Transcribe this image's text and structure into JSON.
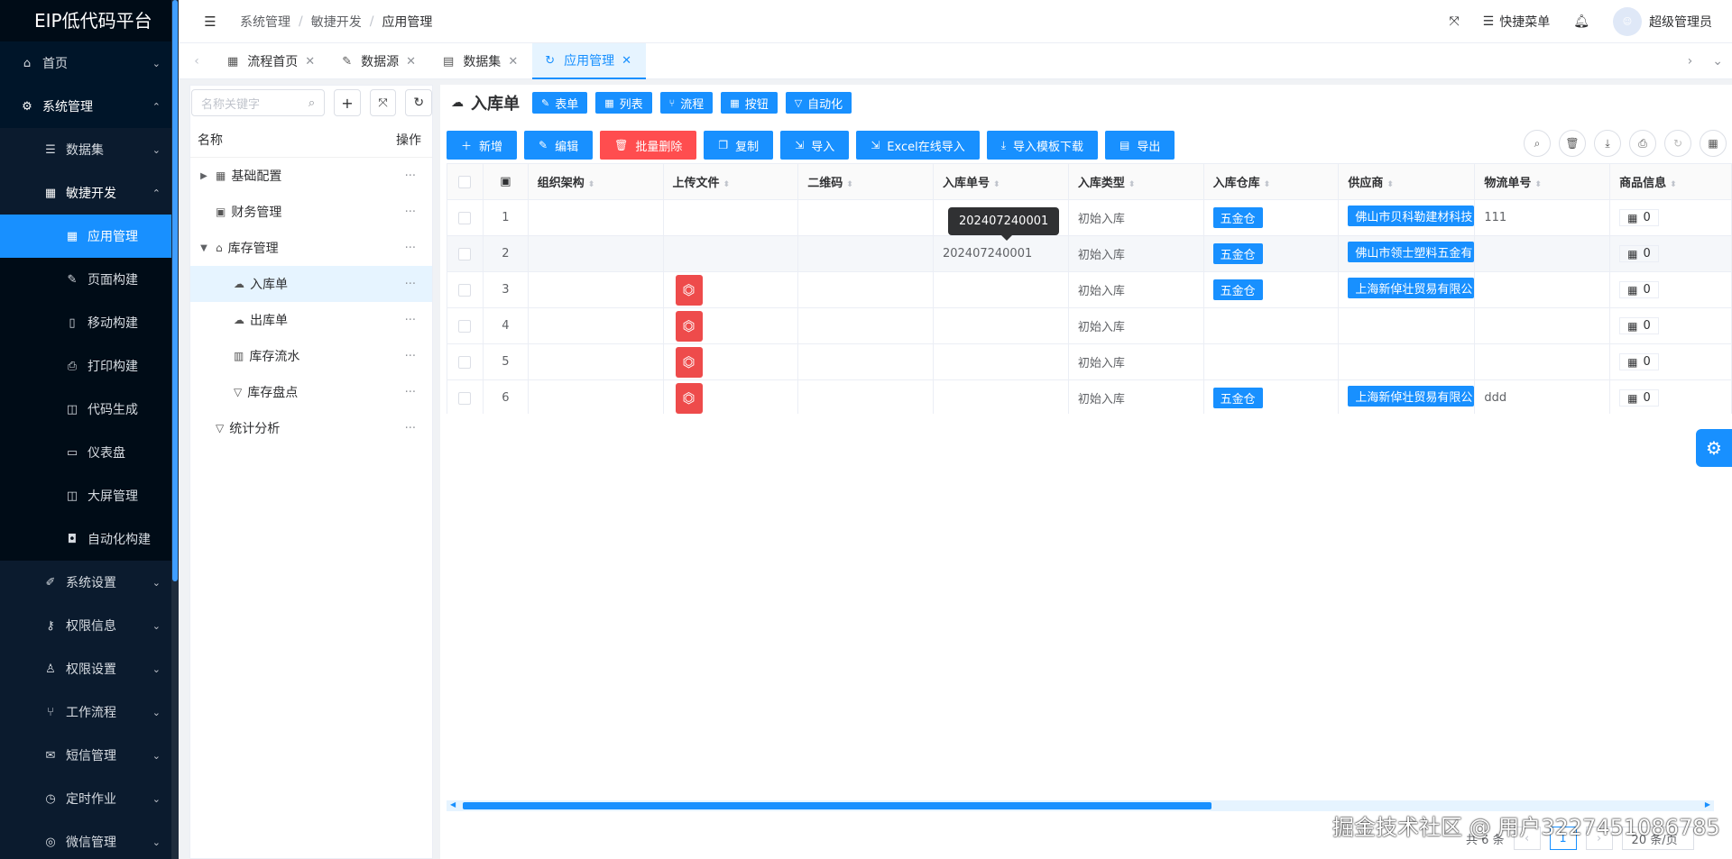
{
  "app": {
    "title": "EIP低代码平台"
  },
  "sidebar": {
    "items": [
      {
        "label": "首页",
        "icon": "home-icon"
      },
      {
        "label": "系统管理",
        "icon": "gear-icon"
      },
      {
        "label": "数据集",
        "icon": "list-icon"
      },
      {
        "label": "敏捷开发",
        "icon": "grid-icon"
      },
      {
        "label": "应用管理",
        "icon": "grid-icon"
      },
      {
        "label": "页面构建",
        "icon": "edit-icon"
      },
      {
        "label": "移动构建",
        "icon": "mobile-icon"
      },
      {
        "label": "打印构建",
        "icon": "printer-icon"
      },
      {
        "label": "代码生成",
        "icon": "code-icon"
      },
      {
        "label": "仪表盘",
        "icon": "dashboard-icon"
      },
      {
        "label": "大屏管理",
        "icon": "screen-icon"
      },
      {
        "label": "自动化构建",
        "icon": "robot-icon"
      },
      {
        "label": "系统设置",
        "icon": "wrench-icon"
      },
      {
        "label": "权限信息",
        "icon": "key-icon"
      },
      {
        "label": "权限设置",
        "icon": "user-icon"
      },
      {
        "label": "工作流程",
        "icon": "branch-icon"
      },
      {
        "label": "短信管理",
        "icon": "sms-icon"
      },
      {
        "label": "定时作业",
        "icon": "clock-icon"
      },
      {
        "label": "微信管理",
        "icon": "wechat-icon"
      }
    ]
  },
  "header": {
    "breadcrumb": [
      "系统管理",
      "敏捷开发",
      "应用管理"
    ],
    "quick_menu": "快捷菜单",
    "user": "超级管理员"
  },
  "tabs": [
    {
      "label": "流程首页"
    },
    {
      "label": "数据源"
    },
    {
      "label": "数据集"
    },
    {
      "label": "应用管理"
    }
  ],
  "tree": {
    "search_placeholder": "名称关键字",
    "col_name": "名称",
    "col_op": "操作",
    "more": "···",
    "nodes": [
      {
        "label": "基础配置"
      },
      {
        "label": "财务管理"
      },
      {
        "label": "库存管理"
      },
      {
        "label": "入库单"
      },
      {
        "label": "出库单"
      },
      {
        "label": "库存流水"
      },
      {
        "label": "库存盘点"
      },
      {
        "label": "统计分析"
      }
    ]
  },
  "form": {
    "title": "入库单",
    "design_buttons": [
      "表单",
      "列表",
      "流程",
      "按钮",
      "自动化"
    ]
  },
  "toolbar": {
    "add": "新增",
    "edit": "编辑",
    "batch_delete": "批量删除",
    "copy": "复制",
    "import": "导入",
    "excel_import": "Excel在线导入",
    "template_download": "导入模板下载",
    "export": "导出"
  },
  "table": {
    "columns": [
      "组织架构",
      "上传文件",
      "二维码",
      "入库单号",
      "入库类型",
      "入库仓库",
      "供应商",
      "物流单号",
      "商品信息"
    ],
    "rows": [
      {
        "no": "1",
        "org": "",
        "file": false,
        "qr": "",
        "order_no": "",
        "type": "初始入库",
        "warehouse": "五金仓",
        "supplier": "佛山市贝科勒建材科技",
        "logistics": "111",
        "goods": "0"
      },
      {
        "no": "2",
        "org": "",
        "file": false,
        "qr": "",
        "order_no": "202407240001",
        "type": "初始入库",
        "warehouse": "五金仓",
        "supplier": "佛山市领士塑料五金有",
        "logistics": "",
        "goods": "0"
      },
      {
        "no": "3",
        "org": "",
        "file": true,
        "qr": "",
        "order_no": "",
        "type": "初始入库",
        "warehouse": "五金仓",
        "supplier": "上海新倬壮贸易有限公",
        "logistics": "",
        "goods": "0"
      },
      {
        "no": "4",
        "org": "",
        "file": true,
        "qr": "",
        "order_no": "",
        "type": "初始入库",
        "warehouse": "",
        "supplier": "",
        "logistics": "",
        "goods": "0"
      },
      {
        "no": "5",
        "org": "",
        "file": true,
        "qr": "",
        "order_no": "",
        "type": "初始入库",
        "warehouse": "",
        "supplier": "",
        "logistics": "",
        "goods": "0"
      },
      {
        "no": "6",
        "org": "",
        "file": true,
        "qr": "",
        "order_no": "",
        "type": "初始入库",
        "warehouse": "五金仓",
        "supplier": "上海新倬壮贸易有限公",
        "logistics": "ddd",
        "goods": "0"
      }
    ],
    "tooltip": "202407240001"
  },
  "pager": {
    "total": "共 6 条",
    "current": "1",
    "size": "20 条/页"
  },
  "watermark": "掘金技术社区 @ 用户3227451086785",
  "colors": {
    "primary": "#1890ff",
    "danger": "#ff4d4f",
    "sidebar": "#001529"
  }
}
